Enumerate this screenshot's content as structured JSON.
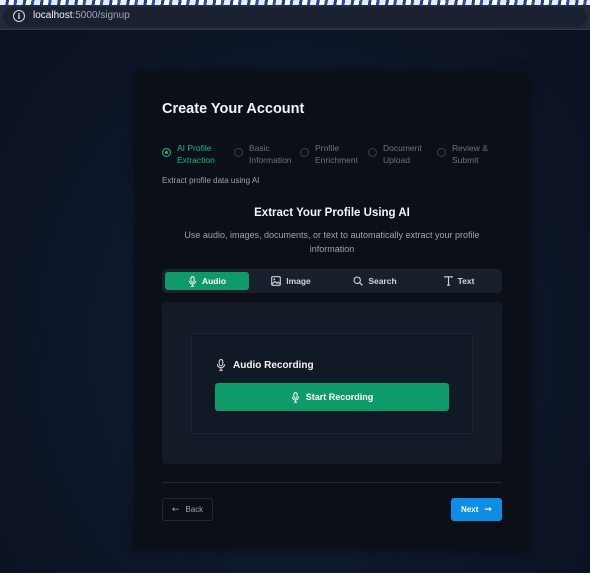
{
  "browser": {
    "url_host": "localhost",
    "url_path": ":5000/signup"
  },
  "card": {
    "title": "Create Your Account",
    "steps": [
      {
        "label": "AI Profile\nExtraction",
        "active": true
      },
      {
        "label": "Basic\nInformation",
        "active": false
      },
      {
        "label": "Profile\nEnrichment",
        "active": false
      },
      {
        "label": "Document\nUpload",
        "active": false
      },
      {
        "label": "Review &\nSubmit",
        "active": false
      }
    ],
    "step_description": "Extract profile data using AI",
    "section_title": "Extract Your Profile Using AI",
    "section_subtitle": "Use audio, images, documents, or text to automatically extract your profile information",
    "tabs": [
      {
        "label": "Audio",
        "icon": "mic-icon",
        "active": true
      },
      {
        "label": "Image",
        "icon": "image-icon",
        "active": false
      },
      {
        "label": "Search",
        "icon": "search-icon",
        "active": false
      },
      {
        "label": "Text",
        "icon": "text-icon",
        "active": false
      }
    ],
    "recording_title": "Audio Recording",
    "start_recording_label": "Start Recording",
    "back_label": "Back",
    "next_label": "Next"
  },
  "colors": {
    "accent_green": "#0f9a6a",
    "step_active": "#10b981",
    "primary_blue": "#0d8de6",
    "card_bg": "#0b0f17"
  }
}
